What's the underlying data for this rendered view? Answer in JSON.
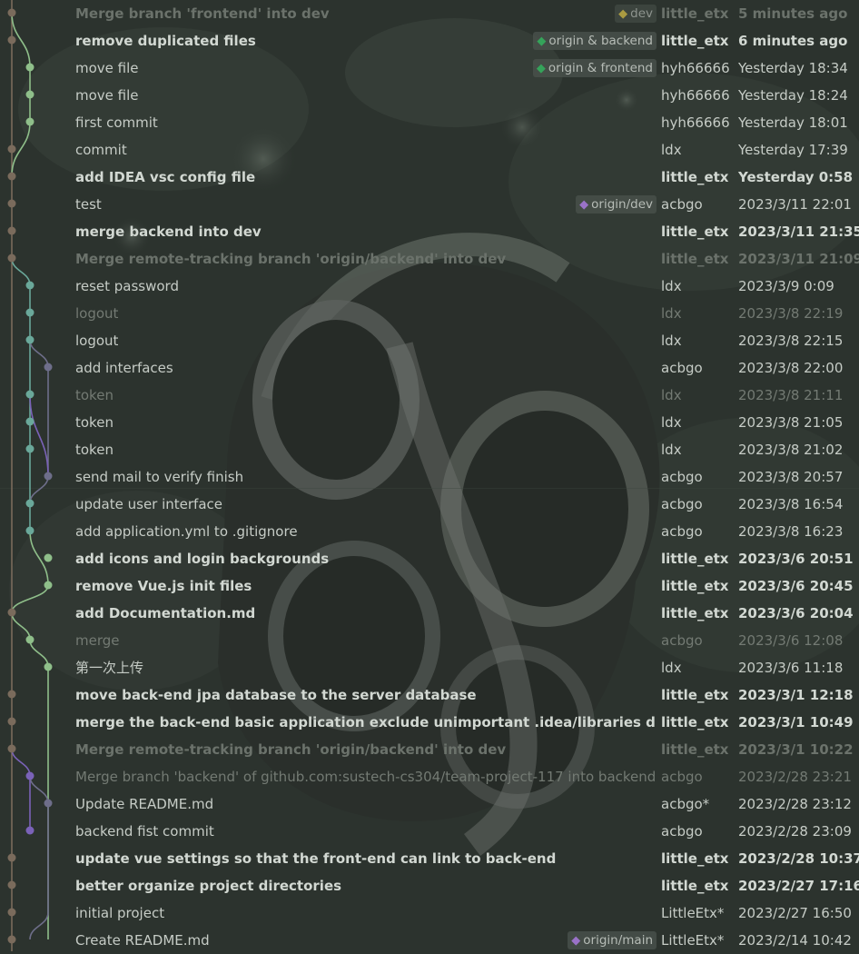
{
  "colors": {
    "background": "#2c332e",
    "branch_main": "#7a6b5c",
    "branch_green": "#8fbf8a",
    "branch_teal": "#6aa89a",
    "branch_purple": "#7a62b8",
    "branch_grey": "#6e6e8a",
    "tag_green": "#35a35a",
    "tag_yellow": "#e0c84a",
    "tag_purple": "#9a72c8"
  },
  "commits": [
    {
      "subject": "Merge branch 'frontend' into dev",
      "ref": "dev",
      "ref_icon": "tag-icon-yellow",
      "author": "little_etx",
      "date": "5 minutes ago",
      "style": "bold dim"
    },
    {
      "subject": "remove duplicated files",
      "ref": "origin & backend",
      "ref_icon": "tag-icon-green",
      "author": "little_etx",
      "date": "6 minutes ago",
      "style": "bold"
    },
    {
      "subject": "move file",
      "ref": "origin & frontend",
      "ref_icon": "tag-icon-green",
      "author": "hyh66666",
      "date": "Yesterday 18:34",
      "style": ""
    },
    {
      "subject": "move file",
      "ref": "",
      "author": "hyh66666",
      "date": "Yesterday 18:24",
      "style": ""
    },
    {
      "subject": "first commit",
      "ref": "",
      "author": "hyh66666",
      "date": "Yesterday 18:01",
      "style": ""
    },
    {
      "subject": "commit",
      "ref": "",
      "author": "ldx",
      "date": "Yesterday 17:39",
      "style": ""
    },
    {
      "subject": "add IDEA vsc config file",
      "ref": "",
      "author": "little_etx",
      "date": "Yesterday 0:58",
      "style": "bold"
    },
    {
      "subject": "test",
      "ref": "origin/dev",
      "ref_icon": "tag-icon-purple",
      "author": "acbgo",
      "date": "2023/3/11 22:01",
      "style": ""
    },
    {
      "subject": "merge backend into dev",
      "ref": "",
      "author": "little_etx",
      "date": "2023/3/11 21:35",
      "style": "bold"
    },
    {
      "subject": "Merge remote-tracking branch 'origin/backend' into dev",
      "ref": "",
      "author": "little_etx",
      "date": "2023/3/11 21:09",
      "style": "bold dim"
    },
    {
      "subject": "reset password",
      "ref": "",
      "author": "ldx",
      "date": "2023/3/9 0:09",
      "style": ""
    },
    {
      "subject": "logout",
      "ref": "",
      "author": "ldx",
      "date": "2023/3/8 22:19",
      "style": "dim"
    },
    {
      "subject": "logout",
      "ref": "",
      "author": "ldx",
      "date": "2023/3/8 22:15",
      "style": ""
    },
    {
      "subject": "add interfaces",
      "ref": "",
      "author": "acbgo",
      "date": "2023/3/8 22:00",
      "style": ""
    },
    {
      "subject": "token",
      "ref": "",
      "author": "ldx",
      "date": "2023/3/8 21:11",
      "style": "dim"
    },
    {
      "subject": "token",
      "ref": "",
      "author": "ldx",
      "date": "2023/3/8 21:05",
      "style": ""
    },
    {
      "subject": "token",
      "ref": "",
      "author": "ldx",
      "date": "2023/3/8 21:02",
      "style": ""
    },
    {
      "subject": "send mail to verify finish",
      "ref": "",
      "author": "acbgo",
      "date": "2023/3/8 20:57",
      "style": ""
    },
    {
      "subject": "update user interface",
      "ref": "",
      "author": "acbgo",
      "date": "2023/3/8 16:54",
      "style": ""
    },
    {
      "subject": "add application.yml to .gitignore",
      "ref": "",
      "author": "acbgo",
      "date": "2023/3/8 16:23",
      "style": ""
    },
    {
      "subject": "add icons and login backgrounds",
      "ref": "",
      "author": "little_etx",
      "date": "2023/3/6 20:51",
      "style": "bold"
    },
    {
      "subject": "remove Vue.js init files",
      "ref": "",
      "author": "little_etx",
      "date": "2023/3/6 20:45",
      "style": "bold"
    },
    {
      "subject": "add Documentation.md",
      "ref": "",
      "author": "little_etx",
      "date": "2023/3/6 20:04",
      "style": "bold"
    },
    {
      "subject": "merge",
      "ref": "",
      "author": "acbgo",
      "date": "2023/3/6 12:08",
      "style": "dim"
    },
    {
      "subject": "第一次上传",
      "ref": "",
      "author": "ldx",
      "date": "2023/3/6 11:18",
      "style": ""
    },
    {
      "subject": "move back-end jpa database to the server database",
      "ref": "",
      "author": "little_etx",
      "date": "2023/3/1 12:18",
      "style": "bold"
    },
    {
      "subject": "merge the back-end basic application exclude unimportant .idea/libraries dictionary",
      "ref": "",
      "author": "little_etx",
      "date": "2023/3/1 10:49",
      "style": "bold"
    },
    {
      "subject": "Merge remote-tracking branch 'origin/backend' into dev",
      "ref": "",
      "author": "little_etx",
      "date": "2023/3/1 10:22",
      "style": "bold dim"
    },
    {
      "subject": "Merge branch 'backend' of github.com:sustech-cs304/team-project-117 into backend ba",
      "ref": "",
      "author": "acbgo",
      "date": "2023/2/28 23:21",
      "style": "dim"
    },
    {
      "subject": "Update README.md",
      "ref": "",
      "author": "acbgo*",
      "date": "2023/2/28 23:12",
      "style": ""
    },
    {
      "subject": "backend fist commit",
      "ref": "",
      "author": "acbgo",
      "date": "2023/2/28 23:09",
      "style": ""
    },
    {
      "subject": "update vue settings so that the front-end can link to back-end",
      "ref": "",
      "author": "little_etx",
      "date": "2023/2/28 10:37",
      "style": "bold"
    },
    {
      "subject": "better organize project directories",
      "ref": "",
      "author": "little_etx",
      "date": "2023/2/27 17:16",
      "style": "bold"
    },
    {
      "subject": "initial project",
      "ref": "",
      "author": "LittleEtx*",
      "date": "2023/2/27 16:50",
      "style": ""
    },
    {
      "subject": "Create README.md",
      "ref": "origin/main",
      "ref_icon": "tag-icon-purple",
      "author": "LittleEtx*",
      "date": "2023/2/14 10:42",
      "style": ""
    }
  ]
}
